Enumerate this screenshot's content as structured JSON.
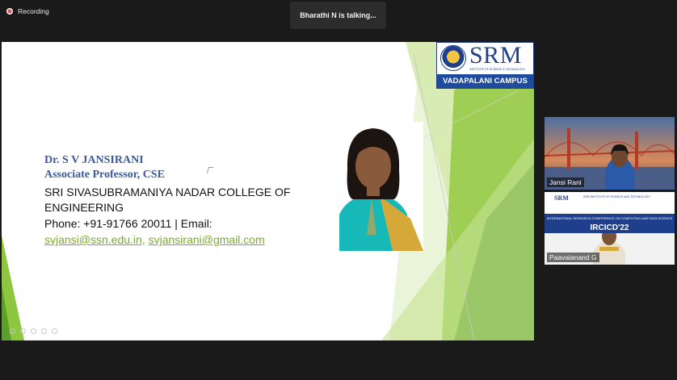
{
  "recording": {
    "label": "Recording"
  },
  "talking_indicator": {
    "text": "Bharathi N is talking..."
  },
  "slide": {
    "logo": {
      "name": "SRM",
      "subtitle": "INSTITUTE OF SCIENCE & TECHNOLOGY",
      "campus": "VADAPALANI CAMPUS"
    },
    "speaker_name": "Dr. S V JANSIRANI",
    "speaker_title": "Associate Professor, CSE",
    "college_line1": "SRI SIVASUBRAMANIYA NADAR COLLEGE OF",
    "college_line2": "ENGINEERING",
    "phone_line": "Phone: +91-91766 20011 | Email:",
    "email1": "svjansi@ssn.edu.in,",
    "email2": "svjansirani@gmail.com"
  },
  "participants": [
    {
      "name": "Jansi Rani"
    },
    {
      "name": "Paavaianand G",
      "banner": {
        "org": "SRM",
        "institute": "SRM INSTITUTE OF SCIENCE AND TECHNOLOGY",
        "conference": "INTERNATIONAL RESEARCH CONFERENCE ON COMPUTING AND DATA SCIENCE",
        "event": "IRCICD'22"
      }
    }
  ],
  "colors": {
    "accent_green": "#8dc63f",
    "brand_blue": "#1f3f8c",
    "name_blue": "#3a5a9c",
    "link_green": "#7aab2a"
  }
}
